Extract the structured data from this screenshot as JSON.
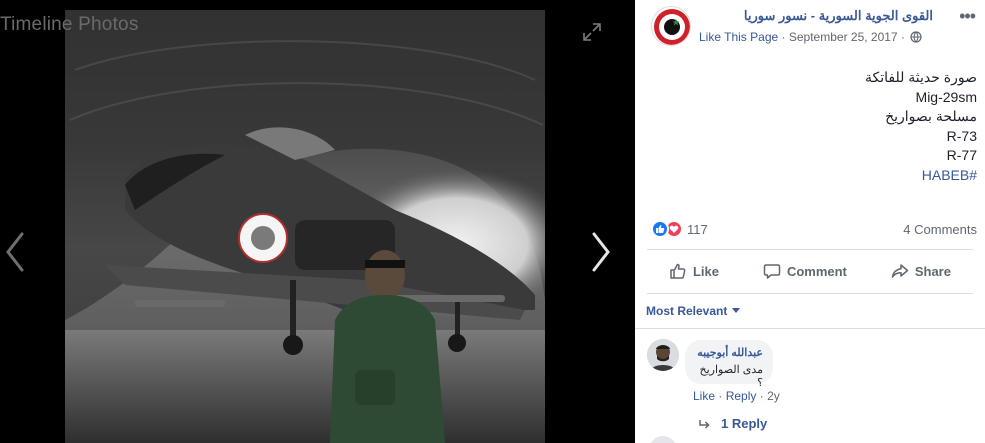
{
  "viewer": {
    "title": "Timeline Photos"
  },
  "post": {
    "page_name": "القوى الجوية السورية - نسور سوريا",
    "like_page": "Like This Page",
    "separator": "·",
    "date": "September 25, 2017",
    "text_lines": [
      "صورة حديثة للفاتكة",
      "Mig-29sm",
      "مسلحة بصواريخ",
      "R-73",
      "R-77"
    ],
    "hashtag": "HABEB#"
  },
  "reactions": {
    "count": "117",
    "comments": "4 Comments"
  },
  "actions": {
    "like": "Like",
    "comment": "Comment",
    "share": "Share"
  },
  "sort": {
    "label": "Most Relevant"
  },
  "comment": {
    "author": "عبدالله أبوجيبه",
    "text": "مدى الصواريخ ؟",
    "like": "Like",
    "dot": "·",
    "reply": "Reply",
    "age": "2y"
  },
  "replies": {
    "label": "1 Reply"
  },
  "colors": {
    "link": "#385898",
    "like_blue": "#1877f2",
    "love_red": "#f33e58"
  }
}
